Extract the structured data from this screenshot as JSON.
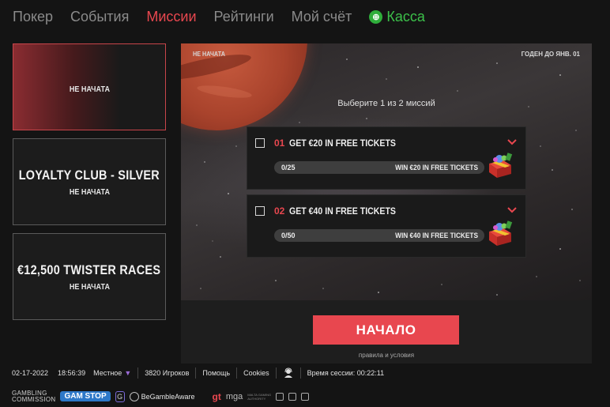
{
  "nav": {
    "items": [
      {
        "label": "Покер"
      },
      {
        "label": "События"
      },
      {
        "label": "Миссии"
      },
      {
        "label": "Рейтинги"
      },
      {
        "label": "Мой счёт"
      }
    ],
    "active_index": 2,
    "cash_label": "Касса",
    "cash_icon": "cashier-icon"
  },
  "missions_list": [
    {
      "title": "",
      "status": "НЕ НАЧАТА"
    },
    {
      "title": "LOYALTY CLUB - SILVER",
      "status": "НЕ НАЧАТА"
    },
    {
      "title": "€12,500 TWISTER RACES",
      "status": "НЕ НАЧАТА"
    }
  ],
  "panel": {
    "status": "НЕ НАЧАТА",
    "deadline": "ГОДЕН ДО ЯНВ. 01",
    "choose_text": "Выберите 1 из 2 миссий",
    "missions": [
      {
        "number": "01",
        "title": "GET €20 IN FREE TICKETS",
        "progress_text": "0/25",
        "progress": 0,
        "reward": "WIN €20 IN FREE TICKETS"
      },
      {
        "number": "02",
        "title": "GET €40 IN FREE TICKETS",
        "progress_text": "0/50",
        "progress": 0,
        "reward": "WIN €40 IN FREE TICKETS"
      }
    ],
    "start_label": "НАЧАЛО",
    "terms_label": "правила и условия"
  },
  "status_bar": {
    "date": "02-17-2022",
    "time": "18:56:39",
    "timezone": "Местное",
    "players": "3820 Игроков",
    "help": "Помощь",
    "cookies": "Cookies",
    "session": "Время сессии: 00:22:11"
  },
  "footer": {
    "gambling_commission_line1": "GAMBLING",
    "gambling_commission_line2": "COMMISSION",
    "gamstop": "GAM STOP",
    "gamcare": "G",
    "begambleaware": "BeGambleAware",
    "gt": "gt",
    "mga": "mga",
    "mga_sub1": "MALTA GAMING",
    "mga_sub2": "AUTHORITY"
  },
  "colors": {
    "accent": "#e8474f",
    "cash": "#3cc14a",
    "background": "#141414"
  }
}
